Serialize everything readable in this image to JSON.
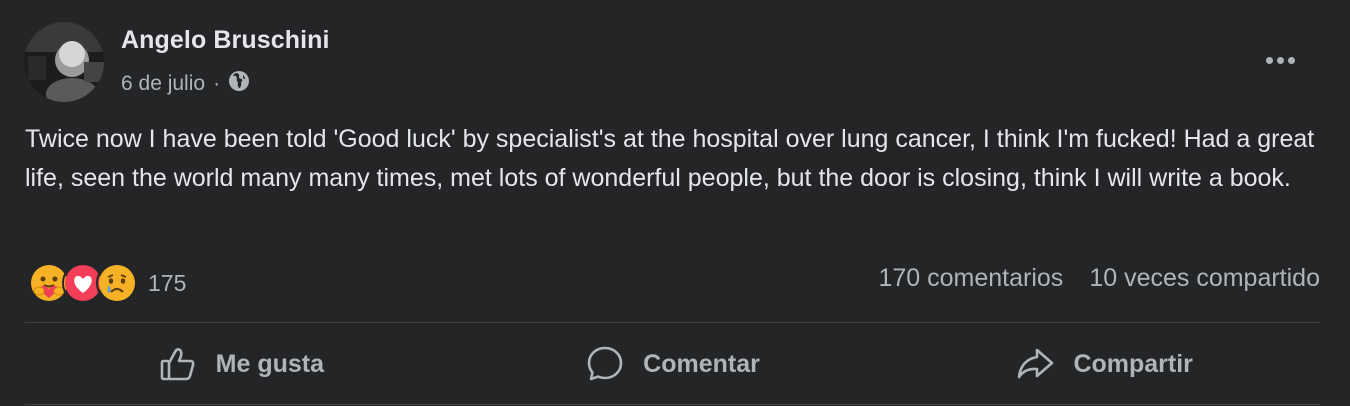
{
  "post": {
    "author": "Angelo Bruschini",
    "date": "6 de julio",
    "separator": "·",
    "privacy_icon": "globe-icon",
    "more_icon": "more-options-icon",
    "text": "Twice now I have been told 'Good luck' by specialist's at the hospital over lung cancer, I think I'm fucked! Had a great life, seen the world many many times, met lots of wonderful people, but the door is closing, think I will write a book."
  },
  "reactions": {
    "icons": [
      "care-icon",
      "love-icon",
      "sad-icon"
    ],
    "count": "175"
  },
  "stats": {
    "comments": "170 comentarios",
    "shares": "10 veces compartido"
  },
  "actions": {
    "like": "Me gusta",
    "comment": "Comentar",
    "share": "Compartir"
  },
  "colors": {
    "background": "#242526",
    "text_primary": "#e4e6eb",
    "text_secondary": "#b0b3b8",
    "divider": "#3e4042",
    "love": "#f33e58",
    "reaction_yellow": "#f7b125"
  }
}
